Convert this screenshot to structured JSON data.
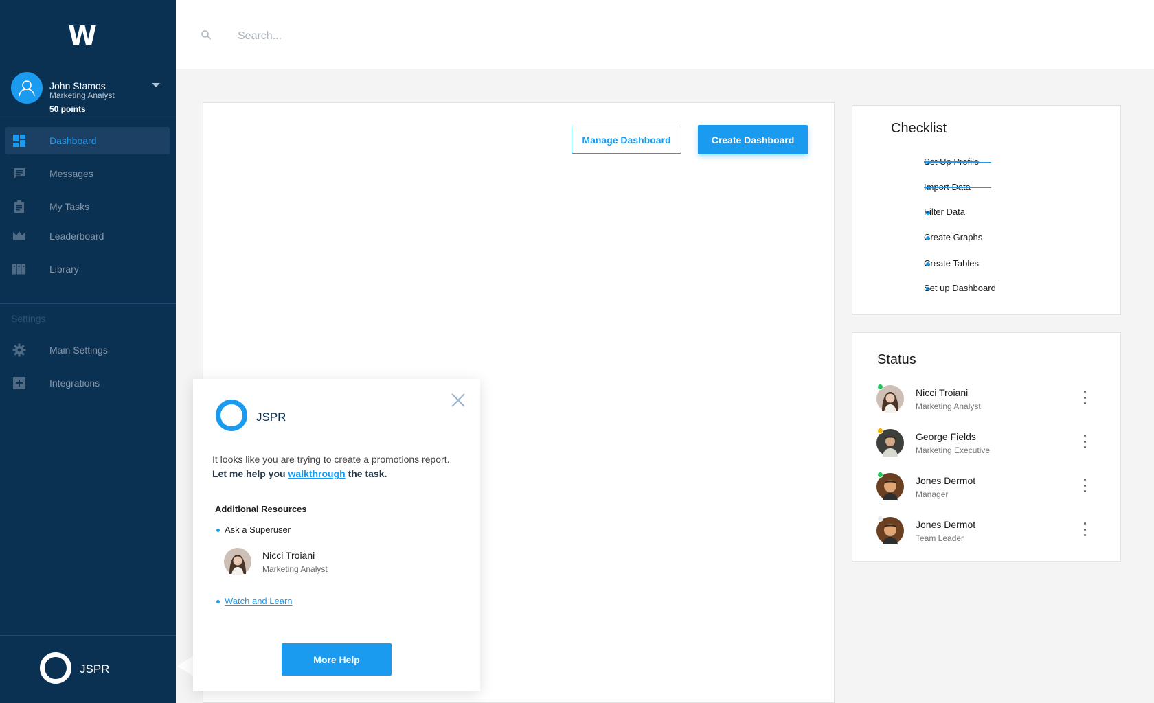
{
  "app": {
    "logo": "W"
  },
  "user": {
    "name": "John Stamos",
    "role": "Marketing Analyst",
    "points": "50 points"
  },
  "nav": [
    {
      "label": "Dashboard",
      "icon": "dashboard-icon",
      "active": true
    },
    {
      "label": "Messages",
      "icon": "message-icon",
      "active": false
    },
    {
      "label": "My Tasks",
      "icon": "clipboard-icon",
      "active": false
    },
    {
      "label": "Leaderboard",
      "icon": "crown-icon",
      "active": false
    },
    {
      "label": "Library",
      "icon": "library-icon",
      "active": false
    }
  ],
  "settings": {
    "heading": "Settings",
    "items": [
      {
        "label": "Main Settings",
        "icon": "gear-icon"
      },
      {
        "label": "Integrations",
        "icon": "plus-box-icon"
      }
    ]
  },
  "assistant": {
    "name": "JSPR"
  },
  "search": {
    "placeholder": "Search..."
  },
  "toolbar": {
    "manage_label": "Manage Dashboard",
    "create_label": "Create Dashboard"
  },
  "popup": {
    "title": "JSPR",
    "message_line1": "It looks like you are trying to create a promotions report.",
    "message_line2_pre": "Let me help you ",
    "message_link": "walkthrough",
    "message_line2_post": " the task.",
    "resources_heading": "Additional Resources",
    "ask_label": "Ask a Superuser",
    "superuser": {
      "name": "Nicci Troiani",
      "role": "Marketing Analyst"
    },
    "watch_label": "Watch and Learn",
    "more_help_label": "More Help"
  },
  "checklist": {
    "title": "Checklist",
    "items": [
      {
        "label": "Set Up Profile",
        "done": true
      },
      {
        "label": "Import Data",
        "done": true
      },
      {
        "label": "Filter Data",
        "done": false
      },
      {
        "label": "Create Graphs",
        "done": false
      },
      {
        "label": "Create Tables",
        "done": false
      },
      {
        "label": "Set up Dashboard",
        "done": false
      }
    ]
  },
  "status": {
    "title": "Status",
    "people": [
      {
        "name": "Nicci Troiani",
        "role": "Marketing Analyst",
        "presence": "#22c55e"
      },
      {
        "name": "George Fields",
        "role": "Marketing Executive",
        "presence": "#f5b301"
      },
      {
        "name": "Jones Dermot",
        "role": "Manager",
        "presence": "#22c55e"
      },
      {
        "name": "Jones Dermot",
        "role": "Team Leader",
        "presence": "#e5e7eb"
      }
    ]
  },
  "colors": {
    "sidebar": "#0b3152",
    "accent": "#1a9bf0"
  }
}
